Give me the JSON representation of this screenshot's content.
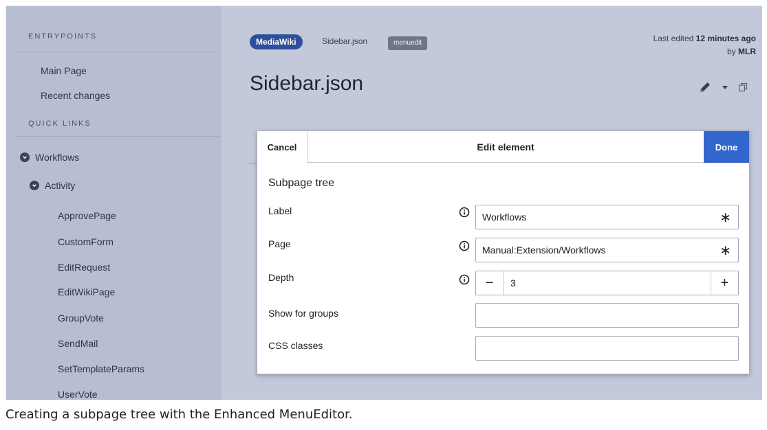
{
  "sidebar": {
    "section_entrypoints": "ENTRYPOINTS",
    "entry_links": [
      "Main Page",
      "Recent changes"
    ],
    "section_quicklinks": "QUICK LINKS",
    "tree_root": "Workflows",
    "tree_child": "Activity",
    "activity_items": [
      "ApprovePage",
      "CustomForm",
      "EditRequest",
      "EditWikiPage",
      "GroupVote",
      "SendMail",
      "SetTemplateParams",
      "UserVote"
    ]
  },
  "header": {
    "namespace_badge": "MediaWiki",
    "breadcrumb": "Sidebar.json",
    "tag": "menuedit",
    "last_edited_prefix": "Last edited",
    "last_edited_time": "12 minutes ago",
    "by_prefix": "by",
    "editor": "MLR",
    "page_title": "Sidebar.json"
  },
  "dialog": {
    "cancel_label": "Cancel",
    "title": "Edit element",
    "done_label": "Done",
    "section_title": "Subpage tree",
    "fields": {
      "label": {
        "label": "Label",
        "value": "Workflows",
        "required": "∗"
      },
      "page": {
        "label": "Page",
        "value": "Manual:Extension/Workflows",
        "required": "∗"
      },
      "depth": {
        "label": "Depth",
        "value": "3",
        "minus": "−",
        "plus": "+"
      },
      "groups": {
        "label": "Show for groups",
        "value": ""
      },
      "css": {
        "label": "CSS classes",
        "value": ""
      }
    }
  },
  "caption": "Creating a subpage tree with the Enhanced MenuEditor.",
  "colors": {
    "primary": "#3366cc",
    "badge": "#2f4f9a",
    "sidebar_bg": "#b7bed3",
    "content_bg": "#c3c8da"
  }
}
